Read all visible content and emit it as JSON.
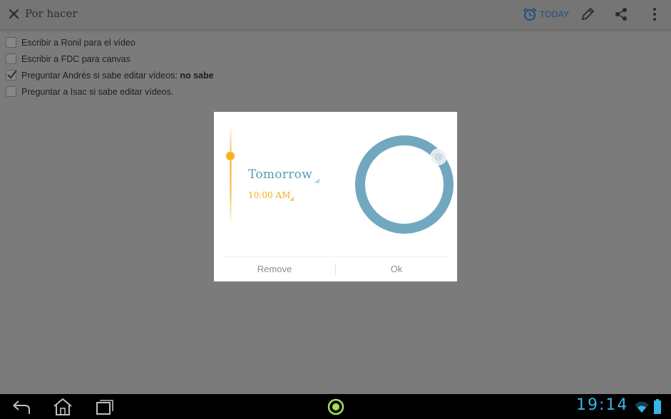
{
  "app": {
    "title": "Por hacer",
    "toolbar": {
      "today_label": "TODAY",
      "icons": [
        "close-icon",
        "alarm-clock-icon",
        "pencil-icon",
        "share-icon",
        "overflow-menu-icon"
      ]
    },
    "tasks": [
      {
        "text": "Escribir a Ronil para el vídeo",
        "bold_suffix": "",
        "checked": false
      },
      {
        "text": "Escribir a FDC para canvas",
        "bold_suffix": "",
        "checked": false
      },
      {
        "text": "Preguntar Andrés si sabe editar vídeos: ",
        "bold_suffix": "no sabe",
        "checked": true
      },
      {
        "text": "Preguntar a Isac si sabe editar vídeos.",
        "bold_suffix": "",
        "checked": false
      }
    ]
  },
  "dialog": {
    "day_label": "Tomorrow",
    "time_label": "10:00 AM",
    "remove_label": "Remove",
    "ok_label": "Ok",
    "accent_blue": "#6fa9bf",
    "accent_orange": "#f2ad1a"
  },
  "system": {
    "clock": "19:14",
    "icons": [
      "back-icon",
      "home-icon",
      "recent-apps-icon",
      "app-indicator-icon",
      "wifi-icon",
      "battery-icon"
    ]
  }
}
